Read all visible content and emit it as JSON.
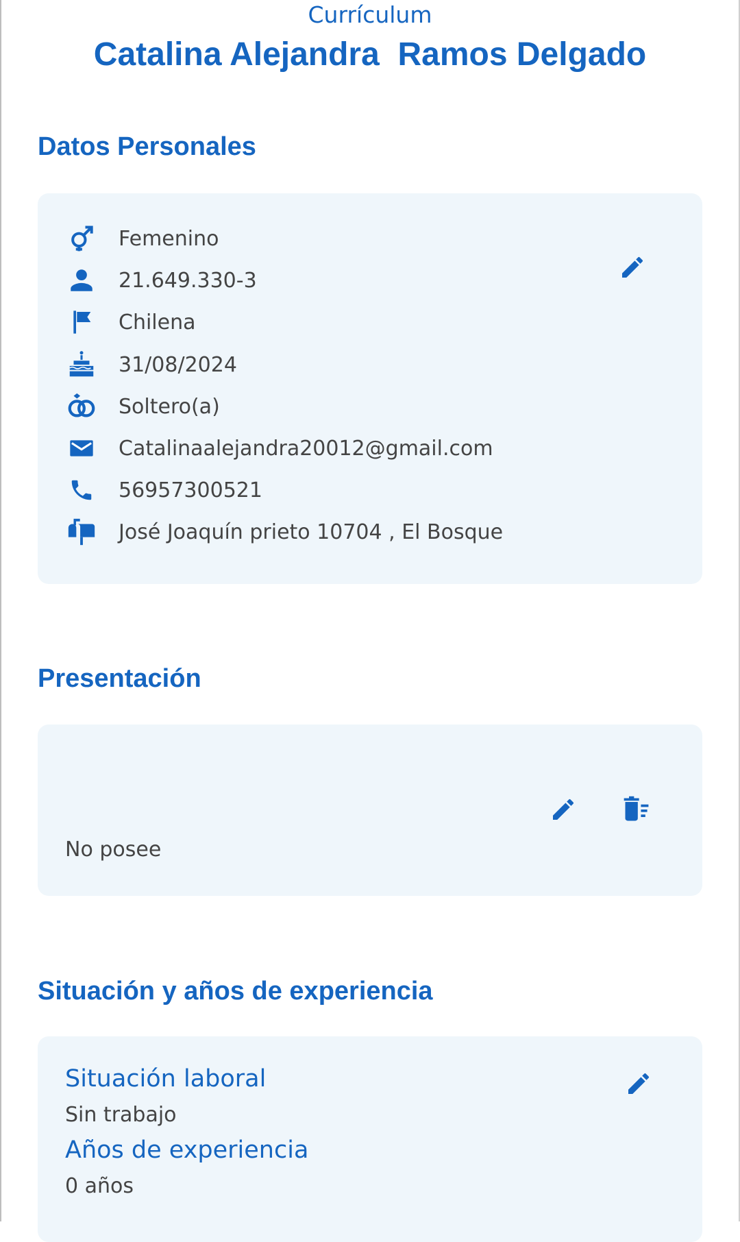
{
  "header": {
    "doc_label": "Currículum",
    "name": "Catalina Alejandra  Ramos Delgado"
  },
  "personal": {
    "title": "Datos Personales",
    "items": [
      {
        "icon": "gender-icon",
        "value": "Femenino"
      },
      {
        "icon": "person-icon",
        "value": "21.649.330-3"
      },
      {
        "icon": "flag-icon",
        "value": "Chilena"
      },
      {
        "icon": "cake-icon",
        "value": "31/08/2024"
      },
      {
        "icon": "rings-icon",
        "value": "Soltero(a)"
      },
      {
        "icon": "email-icon",
        "value": "Catalinaalejandra20012@gmail.com"
      },
      {
        "icon": "phone-icon",
        "value": "56957300521"
      },
      {
        "icon": "mailbox-icon",
        "value": "José Joaquín prieto 10704 , El Bosque"
      }
    ]
  },
  "presentation": {
    "title": "Presentación",
    "text": "No posee"
  },
  "experience": {
    "title": "Situación y años de experiencia",
    "status_label": "Situación laboral",
    "status_value": "Sin trabajo",
    "years_label": "Años de experiencia",
    "years_value": "0 años"
  },
  "colors": {
    "accent": "#1565c0",
    "card_bg": "#eff6fb",
    "text": "#444444"
  }
}
